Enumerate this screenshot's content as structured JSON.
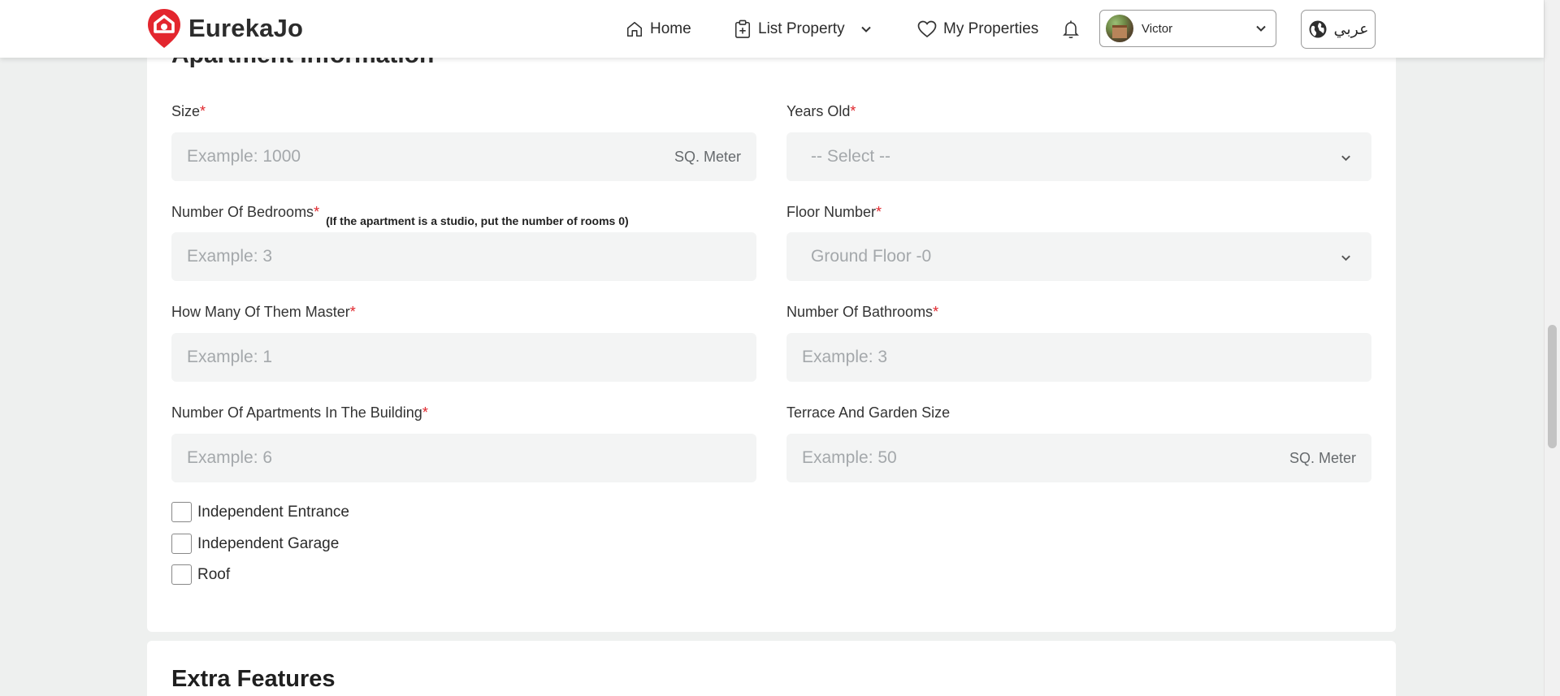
{
  "brand": {
    "name": "EurekaJo",
    "color": "#e3262e"
  },
  "nav": {
    "home": "Home",
    "list_property": "List Property",
    "my_properties": "My Properties",
    "user": "Victor",
    "language": "عربي"
  },
  "section": {
    "title": "Apartment Information",
    "fields": {
      "size": {
        "label": "Size",
        "placeholder": "Example: 1000",
        "unit": "SQ. Meter"
      },
      "years_old": {
        "label": "Years Old",
        "selected": "-- Select --"
      },
      "bedrooms": {
        "label": "Number Of Bedrooms",
        "hint": "(If the apartment is a studio, put the number of rooms 0)",
        "placeholder": "Example: 3"
      },
      "floor_number": {
        "label": "Floor Number",
        "selected": "Ground Floor -0"
      },
      "master": {
        "label": "How Many Of Them Master",
        "placeholder": "Example: 1"
      },
      "bathrooms": {
        "label": "Number Of Bathrooms",
        "placeholder": "Example: 3"
      },
      "apartments": {
        "label": "Number Of Apartments In The Building",
        "placeholder": "Example: 6"
      },
      "terrace": {
        "label": "Terrace And Garden Size",
        "placeholder": "Example: 50",
        "unit": "SQ. Meter"
      }
    },
    "required_marker": "*",
    "checkboxes": [
      {
        "label": "Independent Entrance",
        "checked": false
      },
      {
        "label": "Independent Garage",
        "checked": false
      },
      {
        "label": "Roof",
        "checked": false
      }
    ]
  },
  "extra": {
    "title": "Extra Features"
  }
}
